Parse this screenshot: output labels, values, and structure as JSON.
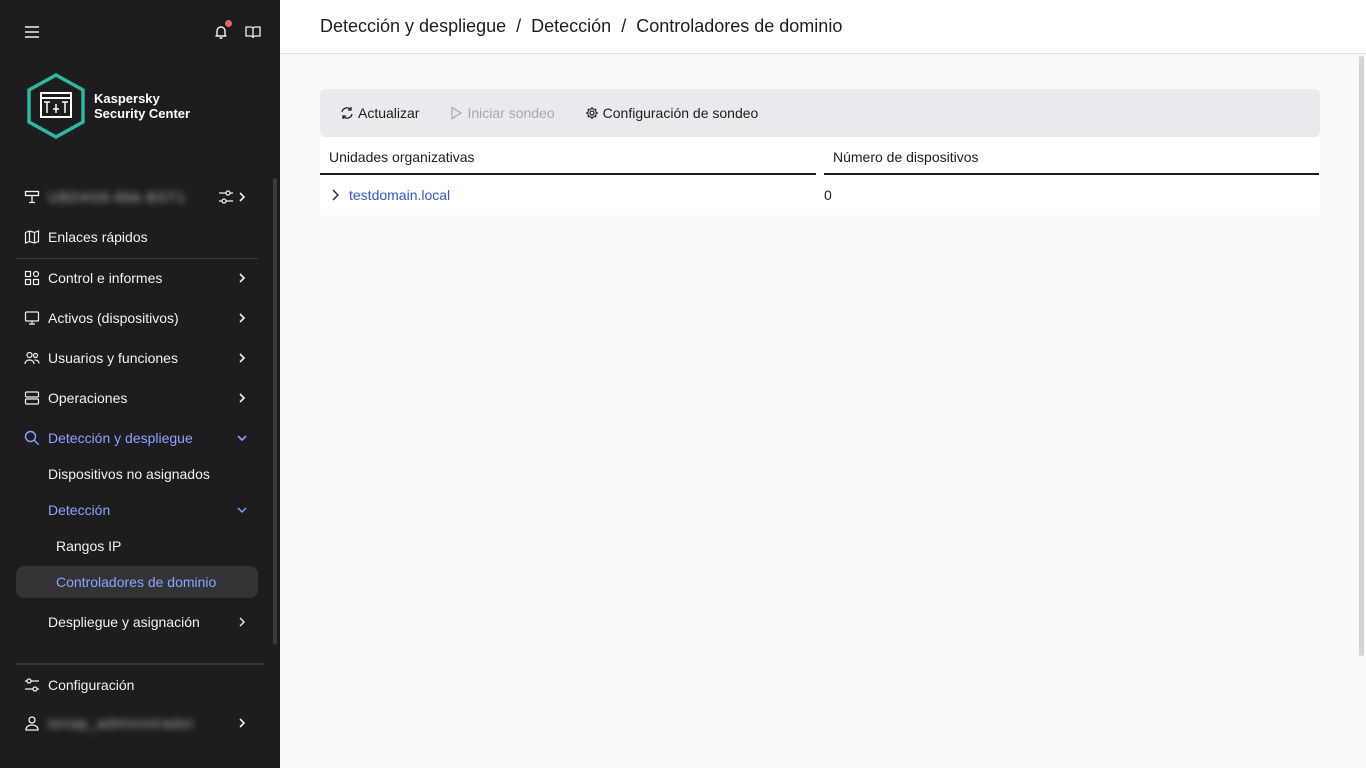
{
  "breadcrumb": [
    "Detección y despliegue",
    "Detección",
    "Controladores de dominio"
  ],
  "brand": {
    "line1": "Kaspersky",
    "line2": "Security Center"
  },
  "sidebar": {
    "server_name": "UBD4G6-8bk-BST1",
    "items": [
      {
        "label": "Enlaces rápidos"
      },
      {
        "label": "Control e informes"
      },
      {
        "label": "Activos (dispositivos)"
      },
      {
        "label": "Usuarios y funciones"
      },
      {
        "label": "Operaciones"
      },
      {
        "label": "Detección y despliegue"
      },
      {
        "label": "Dispositivos no asignados"
      },
      {
        "label": "Detección"
      },
      {
        "label": "Rangos IP"
      },
      {
        "label": "Controladores de dominio"
      },
      {
        "label": "Despliegue y asignación"
      }
    ],
    "settings_label": "Configuración",
    "user_name": "tenap_administrador"
  },
  "toolbar": {
    "refresh_label": "Actualizar",
    "start_poll_label": "Iniciar sondeo",
    "poll_config_label": "Configuración de sondeo"
  },
  "table": {
    "columns": [
      "Unidades organizativas",
      "Número de dispositivos"
    ],
    "rows": [
      {
        "name": "testdomain.local",
        "count": "0"
      }
    ]
  },
  "colors": {
    "sidebar_bg": "#1d1d1f",
    "accent": "#8ea4ff",
    "link": "#3457c8",
    "logo_teal": "#2fb8a0",
    "notification": "#f0625d"
  }
}
